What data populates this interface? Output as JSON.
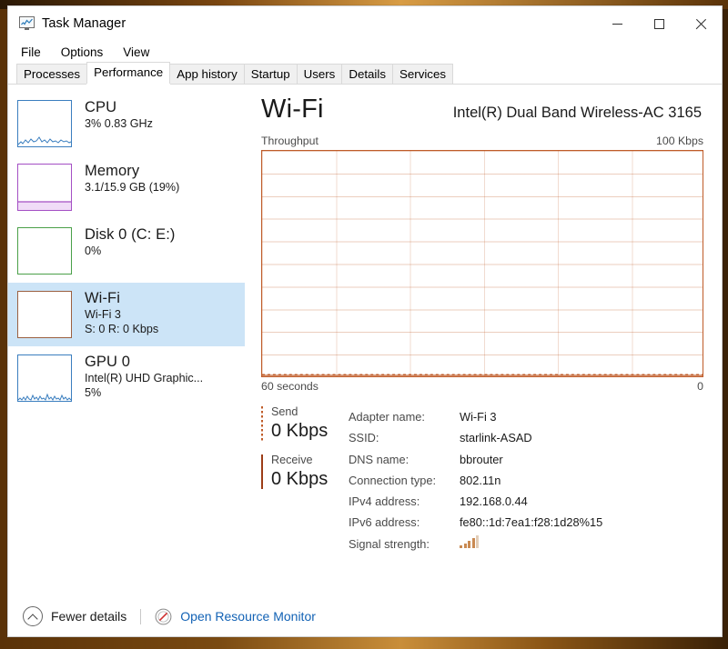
{
  "window": {
    "title": "Task Manager",
    "icon": "task-manager-icon",
    "controls": {
      "minimize": "Minimize",
      "maximize": "Maximize",
      "close": "Close"
    }
  },
  "menu": {
    "items": [
      "File",
      "Options",
      "View"
    ]
  },
  "tabs": [
    {
      "label": "Processes",
      "active": false
    },
    {
      "label": "Performance",
      "active": true
    },
    {
      "label": "App history",
      "active": false
    },
    {
      "label": "Startup",
      "active": false
    },
    {
      "label": "Users",
      "active": false
    },
    {
      "label": "Details",
      "active": false
    },
    {
      "label": "Services",
      "active": false
    }
  ],
  "sidebar": {
    "items": [
      {
        "title": "CPU",
        "sub1": "3%  0.83 GHz",
        "sub2": "",
        "color": "#3a7ebf",
        "selected": false,
        "graph": "sparkline"
      },
      {
        "title": "Memory",
        "sub1": "3.1/15.9 GB (19%)",
        "sub2": "",
        "color": "#a44fc4",
        "selected": false,
        "graph": "fill-bottom"
      },
      {
        "title": "Disk 0 (C: E:)",
        "sub1": "0%",
        "sub2": "",
        "color": "#4aa048",
        "selected": false,
        "graph": "flat"
      },
      {
        "title": "Wi-Fi",
        "sub1": "Wi-Fi 3",
        "sub2": "S: 0 R: 0 Kbps",
        "color": "#9c6040",
        "selected": true,
        "graph": "flat"
      },
      {
        "title": "GPU 0",
        "sub1": "Intel(R) UHD Graphic...",
        "sub2": "5%",
        "color": "#3a7ebf",
        "selected": false,
        "graph": "sparkline"
      }
    ]
  },
  "main": {
    "title": "Wi-Fi",
    "adapter_model": "Intel(R) Dual Band Wireless-AC 3165",
    "chart_caption_left": "Throughput",
    "chart_caption_right": "100 Kbps",
    "axis_left": "60 seconds",
    "axis_right": "0",
    "send": {
      "label": "Send",
      "value": "0 Kbps"
    },
    "receive": {
      "label": "Receive",
      "value": "0 Kbps"
    },
    "info": [
      {
        "key": "Adapter name:",
        "value": "Wi-Fi 3"
      },
      {
        "key": "SSID:",
        "value": "starlink-ASAD"
      },
      {
        "key": "DNS name:",
        "value": "bbrouter"
      },
      {
        "key": "Connection type:",
        "value": "802.11n"
      },
      {
        "key": "IPv4 address:",
        "value": "192.168.0.44"
      },
      {
        "key": "IPv6 address:",
        "value": "fe80::1d:7ea1:f28:1d28%15"
      },
      {
        "key": "Signal strength:",
        "value": ""
      }
    ],
    "signal_strength_bars": 5,
    "signal_strength_filled": 4
  },
  "footer": {
    "fewer_details": "Fewer details",
    "open_resource_monitor": "Open Resource Monitor"
  },
  "chart_data": {
    "type": "line",
    "title": "Throughput",
    "xlabel": "60 seconds",
    "ylabel": "Kbps",
    "ylim": [
      0,
      100
    ],
    "xlim": [
      60,
      0
    ],
    "grid": true,
    "grid_rows": 10,
    "grid_cols": 6,
    "line_color": "#bf5b28",
    "series": [
      {
        "name": "Send",
        "values": [
          0,
          0,
          0,
          0,
          0,
          0,
          0,
          0,
          0,
          0,
          0,
          0,
          0,
          0,
          0,
          0,
          0,
          0,
          0,
          0,
          0,
          0,
          0,
          0,
          0,
          0,
          0,
          0,
          0,
          0,
          0,
          0,
          0,
          0,
          0,
          0,
          0,
          0,
          0,
          0,
          0,
          0,
          0,
          0,
          0,
          0,
          0,
          0,
          0,
          0,
          0,
          0,
          0,
          0,
          0,
          0,
          0,
          0,
          0,
          0
        ]
      },
      {
        "name": "Receive",
        "values": [
          0,
          0,
          0,
          0,
          0,
          0,
          0,
          0,
          0,
          0,
          0,
          0,
          0,
          0,
          0,
          0,
          0,
          0,
          0,
          0,
          0,
          0,
          0,
          0,
          0,
          0,
          0,
          0,
          0,
          0,
          0,
          0,
          0,
          0,
          0,
          0,
          0,
          0,
          0,
          0,
          0,
          0,
          0,
          0,
          0,
          0,
          0,
          0,
          0,
          0,
          0,
          0,
          0,
          0,
          0,
          0,
          0,
          0,
          0,
          0
        ]
      }
    ]
  },
  "colors": {
    "accent_link": "#1262b5",
    "selection": "#cce4f7",
    "wifi_accent": "#bf5b28"
  }
}
